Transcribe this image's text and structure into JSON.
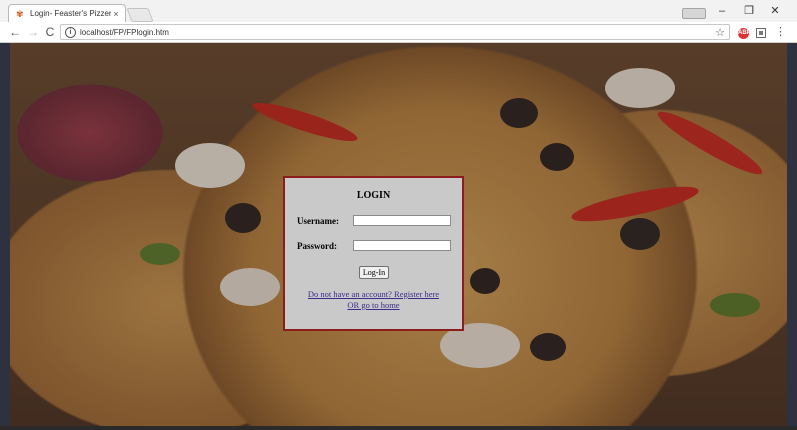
{
  "browser": {
    "tab": {
      "title": "Login- Feaster's Pizzeria",
      "close_symbol": "×",
      "favicon_glyph": "✾"
    },
    "window_controls": {
      "minimize": "–",
      "restore": "❐",
      "close": "✕"
    },
    "nav": {
      "back": "←",
      "forward": "→",
      "reload": "C"
    },
    "address_bar": {
      "info_symbol": "i",
      "url": "localhost/FP/FPlogin.htm",
      "star": "☆"
    },
    "extension_label": "ABP",
    "menu": "⋮"
  },
  "login": {
    "title": "LOGIN",
    "username_label": "Username:",
    "username_value": "",
    "password_label": "Password:",
    "password_value": "",
    "submit_label": "Log-In",
    "register_link": "Do not have an account? Register here",
    "home_link": "OR go to home"
  },
  "colors": {
    "login_border": "#8c1d1d",
    "login_background": "#c9c9c9",
    "link": "#3b2b8c"
  }
}
